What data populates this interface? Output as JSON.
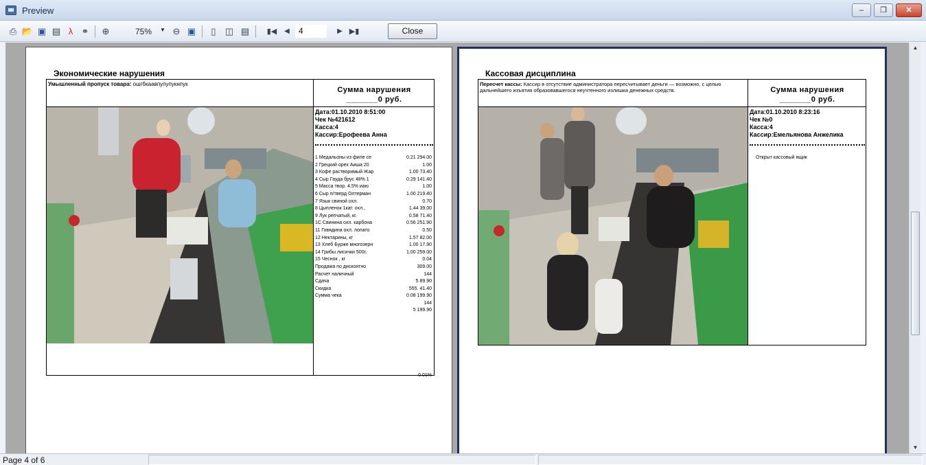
{
  "window": {
    "title": "Preview"
  },
  "toolbar": {
    "zoom": "75%",
    "page_input": "4",
    "close_label": "Close",
    "icons": [
      "print-icon",
      "open-icon",
      "save-icon",
      "page-setup-icon",
      "pdf-export-icon",
      "find-icon",
      "zoom-in-icon",
      "zoom-dropdown-icon",
      "zoom-out-icon",
      "fit-page-icon",
      "single-page-icon",
      "two-pages-icon",
      "book-view-icon",
      "first-page-icon",
      "prev-page-icon",
      "next-page-icon",
      "last-page-icon"
    ]
  },
  "pages": [
    {
      "title": "Экономические нарушения",
      "description_label": "Умышленный пропуск товара:",
      "description": "ошгбкаавпупупукнпук",
      "sum_label": "Сумма нарушения",
      "sum_value": "_______0 руб.",
      "date": "Дата:01.10.2010 8:51:00",
      "check": "Чек №421612",
      "register": "Касса:4",
      "cashier": "Кассир:Ерофеева Анна",
      "receipt": [
        {
          "name": "1  Медальоны из филе се",
          "amount": "0.21  294.00"
        },
        {
          "name": "2  Грецкий орех Аиша 20",
          "amount": "1.00        "
        },
        {
          "name": "3  Кофе растворимый Жар",
          "amount": "1.00  73.40"
        },
        {
          "name": "4  Сыр Гауда брус 48% 1",
          "amount": "0.29  141.40"
        },
        {
          "name": "5  Масса твор. 4,5% иаю",
          "amount": "1.00        "
        },
        {
          "name": "6  Сыр п/тверд Олтерман",
          "amount": "1.00  219.40"
        },
        {
          "name": "7  Язык свиной охл.",
          "amount": "0.70        "
        },
        {
          "name": "8  Цыпленок 1кат. охл.,",
          "amount": "1.44  39.00"
        },
        {
          "name": "9  Лук репчатый, кг.",
          "amount": "0.58  71.40"
        },
        {
          "name": "1С Свинина охл. карбона",
          "amount": "0.56  251.90"
        },
        {
          "name": "11 Говядина охл. лопато",
          "amount": "0.50        "
        },
        {
          "name": "12 Нектарины, кг",
          "amount": "1.57  82.00"
        },
        {
          "name": "13 Хлеб Бурже многозерн",
          "amount": "1.00  17.90"
        },
        {
          "name": "14 Грибы лисички 500г,",
          "amount": "1.00  259.00"
        },
        {
          "name": "15 Чеснок , кг",
          "amount": "0.04        "
        },
        {
          "name": "    Продажа по дисконтно",
          "amount": "309.00"
        },
        {
          "name": "    Расчет наличный",
          "amount": "144         "
        },
        {
          "name": "    Сдача",
          "amount": "5    89.90"
        },
        {
          "name": "    Скидка",
          "amount": "555.  41.40"
        },
        {
          "name": "    Сумма чека",
          "amount": "0.08  199.90"
        },
        {
          "name": "",
          "amount": "144         "
        },
        {
          "name": "",
          "amount": "5     199.90"
        }
      ],
      "percent": "0.01%"
    },
    {
      "title": "Кассовая дисциплина",
      "description_label": "Пересчет кассы:",
      "description": "Кассир в отсутствие администратора пересчитывает деньги — возможно, с целью дальнейшего изъятия образовавшегося неучтенного излишка денежных средств.",
      "sum_label": "Сумма нарушения",
      "sum_value": "_______0 руб.",
      "date": "Дата:01.10.2010 8:23:16",
      "check": "Чек №0",
      "register": "Касса:4",
      "cashier": "Кассир:Емельянова Анжелика",
      "event": "Открыт кассовый ящик"
    }
  ],
  "status": {
    "page_text": "Page 4 of 6"
  }
}
